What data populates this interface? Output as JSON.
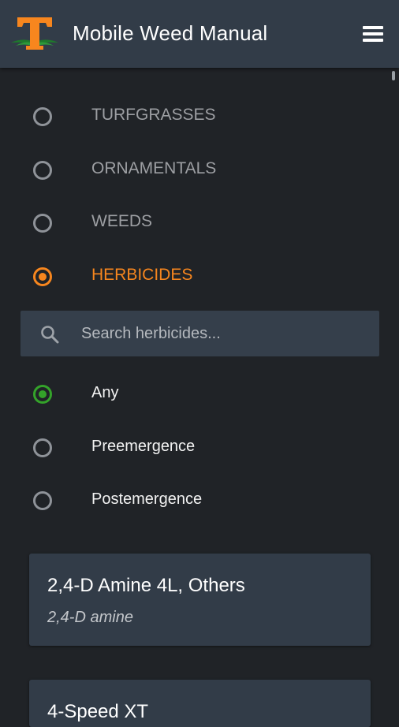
{
  "app": {
    "title": "Mobile Weed Manual",
    "logo_icon": "tennessee-t-logo-icon",
    "menu_icon": "hamburger-menu-icon"
  },
  "colors": {
    "appbar": "#323c48",
    "background": "#202327",
    "accent_orange": "#f7861e",
    "accent_green": "#34a32a",
    "card": "#323c48"
  },
  "categories": [
    {
      "label": "TURFGRASSES",
      "selected": false
    },
    {
      "label": "ORNAMENTALS",
      "selected": false
    },
    {
      "label": "WEEDS",
      "selected": false
    },
    {
      "label": "HERBICIDES",
      "selected": true
    }
  ],
  "search": {
    "placeholder": "Search herbicides...",
    "value": "",
    "icon": "search-icon"
  },
  "filters": [
    {
      "label": "Any",
      "selected": true
    },
    {
      "label": "Preemergence",
      "selected": false
    },
    {
      "label": "Postemergence",
      "selected": false
    }
  ],
  "results": [
    {
      "title": "2,4-D Amine 4L, Others",
      "subtitle": "2,4-D amine"
    },
    {
      "title": "4-Speed XT",
      "subtitle": ""
    }
  ]
}
